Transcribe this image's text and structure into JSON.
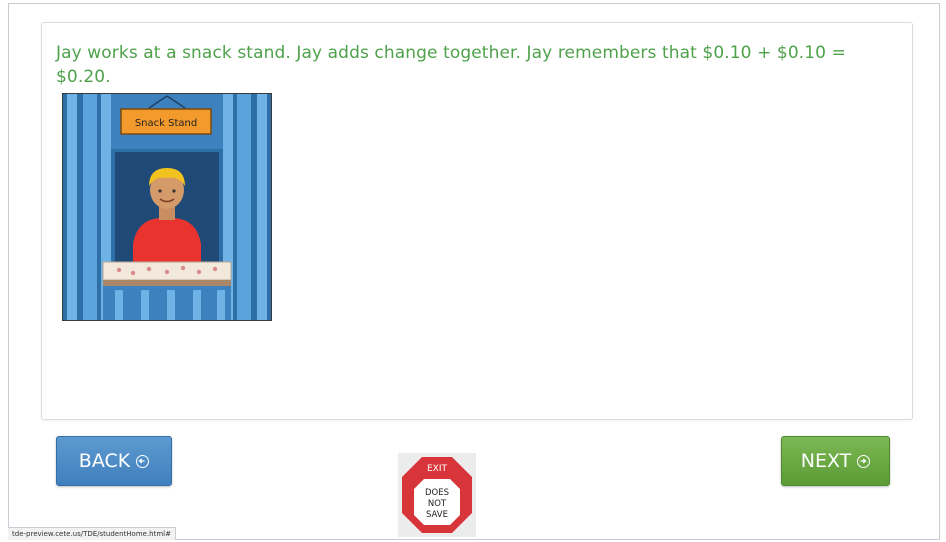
{
  "question": {
    "text": "Jay works at a snack stand. Jay adds change together. Jay remembers that $0.10 + $0.10 = $0.20."
  },
  "illustration": {
    "sign_text": "Snack Stand"
  },
  "navigation": {
    "back_label": "BACK",
    "next_label": "NEXT",
    "back_icon": "circle-arrow-left-icon",
    "next_icon": "circle-arrow-right-icon"
  },
  "exit": {
    "label": "EXIT",
    "sub_line1": "DOES",
    "sub_line2": "NOT",
    "sub_line3": "SAVE"
  },
  "status_bar": {
    "url": "tde-preview.cete.us/TDE/studentHome.html#"
  },
  "colors": {
    "question_text": "#4ea24a",
    "back_button": "#4a88c7",
    "next_button": "#68a843",
    "exit_sign": "#d8353a"
  }
}
